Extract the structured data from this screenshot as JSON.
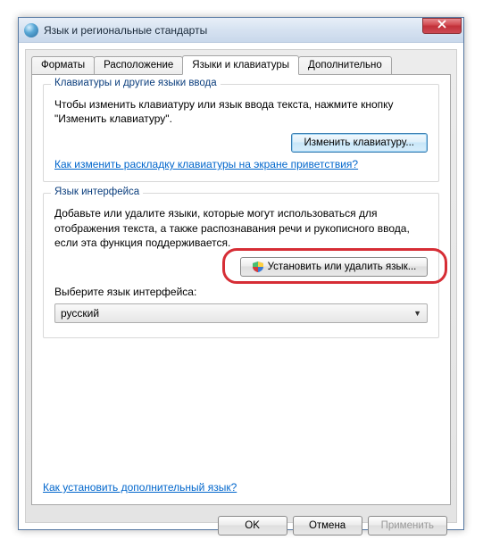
{
  "window": {
    "title": "Язык и региональные стандарты"
  },
  "tabs": [
    {
      "label": "Форматы"
    },
    {
      "label": "Расположение"
    },
    {
      "label": "Языки и клавиатуры"
    },
    {
      "label": "Дополнительно"
    }
  ],
  "group_kbd": {
    "title": "Клавиатуры и другие языки ввода",
    "desc": "Чтобы изменить клавиатуру или язык ввода текста, нажмите кнопку \"Изменить клавиатуру\".",
    "button": "Изменить клавиатуру...",
    "link": "Как изменить раскладку клавиатуры на экране приветствия?"
  },
  "group_lang": {
    "title": "Язык интерфейса",
    "desc": "Добавьте или удалите языки, которые могут использоваться для отображения текста, а также распознавания речи и рукописного ввода, если эта функция поддерживается.",
    "button": "Установить или удалить язык...",
    "select_label": "Выберите язык интерфейса:",
    "select_value": "русский"
  },
  "bottom_link": "Как установить дополнительный язык?",
  "buttons": {
    "ok": "OK",
    "cancel": "Отмена",
    "apply": "Применить"
  }
}
